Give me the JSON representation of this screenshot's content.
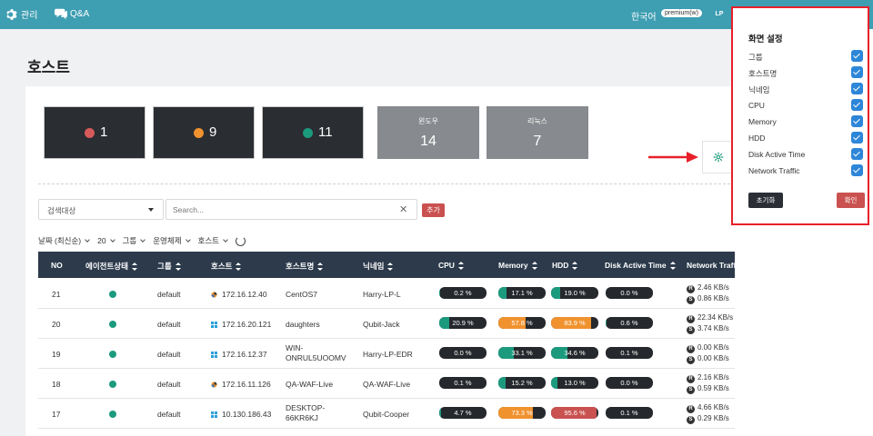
{
  "topbar": {
    "admin_label": "관리",
    "qa_label": "Q&A",
    "language": "한국어",
    "plan_badge": "premium(w)",
    "user_initials": "LP"
  },
  "page_title": "호스트",
  "stats": [
    {
      "count": "1",
      "color": "#d65a5a"
    },
    {
      "count": "9",
      "color": "#f0922e"
    },
    {
      "count": "11",
      "color": "#1c9a7e"
    }
  ],
  "os_stats": [
    {
      "label": "윈도우",
      "value": "14"
    },
    {
      "label": "리눅스",
      "value": "7"
    }
  ],
  "search": {
    "target_select": "검색대상",
    "placeholder": "Search...",
    "add_label": "추가"
  },
  "filters": {
    "sort": "날짜 (최신순)",
    "page_size": "20",
    "group": "그룹",
    "os": "운영체제",
    "host": "호스트"
  },
  "table": {
    "headers": [
      "NO",
      "에이전트상태",
      "그룹",
      "호스트",
      "호스트명",
      "닉네임",
      "CPU",
      "Memory",
      "HDD",
      "Disk Active Time",
      "Network Traffic"
    ],
    "rows": [
      {
        "no": "21",
        "group": "default",
        "os": "linux",
        "host": "172.16.12.40",
        "hostname": "CentOS7",
        "nickname": "Harry-LP-L",
        "cpu": "0.2 %",
        "cpu_v": 0.2,
        "mem": "17.1 %",
        "mem_v": 17.1,
        "hdd": "19.0 %",
        "hdd_v": 19.0,
        "disk": "0.0 %",
        "disk_v": 0.0,
        "net_r": "2.46 KB/s",
        "net_s": "0.86 KB/s"
      },
      {
        "no": "20",
        "group": "default",
        "os": "windows",
        "host": "172.16.20.121",
        "hostname": "daughters",
        "nickname": "Qubit-Jack",
        "cpu": "20.9 %",
        "cpu_v": 20.9,
        "mem": "57.8 %",
        "mem_v": 57.8,
        "hdd": "83.9 %",
        "hdd_v": 83.9,
        "disk": "0.6 %",
        "disk_v": 0.6,
        "net_r": "22.34 KB/s",
        "net_s": "3.74 KB/s"
      },
      {
        "no": "19",
        "group": "default",
        "os": "windows",
        "host": "172.16.12.37",
        "hostname": "WIN-ONRUL5UOOMV",
        "nickname": "Harry-LP-EDR",
        "cpu": "0.0 %",
        "cpu_v": 0.0,
        "mem": "33.1 %",
        "mem_v": 33.1,
        "hdd": "34.6 %",
        "hdd_v": 34.6,
        "disk": "0.1 %",
        "disk_v": 0.1,
        "net_r": "0.00 KB/s",
        "net_s": "0.00 KB/s"
      },
      {
        "no": "18",
        "group": "default",
        "os": "linux",
        "host": "172.16.11.126",
        "hostname": "QA-WAF-Live",
        "nickname": "QA-WAF-Live",
        "cpu": "0.1 %",
        "cpu_v": 0.1,
        "mem": "15.2 %",
        "mem_v": 15.2,
        "hdd": "13.0 %",
        "hdd_v": 13.0,
        "disk": "0.0 %",
        "disk_v": 0.0,
        "net_r": "2.16 KB/s",
        "net_s": "0.59 KB/s"
      },
      {
        "no": "17",
        "group": "default",
        "os": "windows",
        "host": "10.130.186.43",
        "hostname": "DESKTOP-66KR6KJ",
        "nickname": "Qubit-Cooper",
        "cpu": "4.7 %",
        "cpu_v": 4.7,
        "mem": "73.3 %",
        "mem_v": 73.3,
        "hdd": "95.6 %",
        "hdd_v": 95.6,
        "disk": "0.1 %",
        "disk_v": 0.1,
        "net_r": "4.66 KB/s",
        "net_s": "0.29 KB/s"
      }
    ]
  },
  "settings": {
    "title": "화면 설정",
    "items": [
      {
        "label": "그룹",
        "checked": true
      },
      {
        "label": "호스트명",
        "checked": true
      },
      {
        "label": "닉네임",
        "checked": true
      },
      {
        "label": "CPU",
        "checked": true
      },
      {
        "label": "Memory",
        "checked": true
      },
      {
        "label": "HDD",
        "checked": true
      },
      {
        "label": "Disk Active Time",
        "checked": true
      },
      {
        "label": "Network Traffic",
        "checked": true
      }
    ],
    "reset_label": "초기화",
    "confirm_label": "확인"
  },
  "colors": {
    "topbar": "#3e9eb2",
    "accent_red": "#c9514f",
    "ok_green": "#1c9a7e",
    "warn_orange": "#f0922e",
    "crit_red": "#d65a5a",
    "checkbox_blue": "#2d86d8",
    "highlight_border": "#e8202a"
  }
}
